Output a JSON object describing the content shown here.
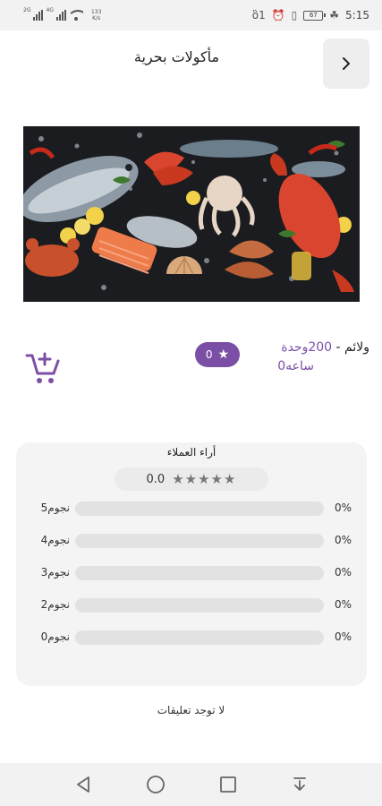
{
  "status_bar": {
    "net_tags": [
      "2G",
      "4G"
    ],
    "speed_value": "133",
    "speed_unit": "K/s",
    "battery": "67",
    "time": "5:15"
  },
  "header": {
    "title": "مأكولات بحرية",
    "back_icon": "chevron-right-icon"
  },
  "hero": {
    "alt": "seafood assortment"
  },
  "product": {
    "rating_value": "0",
    "units_prefix": "ولائم - ",
    "units_value": "200وحدة",
    "hours": "0ساعه",
    "cart_icon": "add-to-cart-icon"
  },
  "reviews": {
    "title": "أراء العملاء",
    "average": "0.0",
    "stars_filled": 0,
    "stars_total": 5,
    "distribution": [
      {
        "label": "5نجوم",
        "percent": "0%",
        "fraction": 0
      },
      {
        "label": "4نجوم",
        "percent": "0%",
        "fraction": 0
      },
      {
        "label": "3نجوم",
        "percent": "0%",
        "fraction": 0
      },
      {
        "label": "2نجوم",
        "percent": "0%",
        "fraction": 0
      },
      {
        "label": "0نجوم",
        "percent": "0%",
        "fraction": 0
      }
    ],
    "empty_message": "لا توجد تعليقات"
  },
  "nav_bar": {
    "buttons": [
      "back-triangle-icon",
      "home-circle-icon",
      "recents-square-icon",
      "notification-down-icon"
    ]
  },
  "colors": {
    "accent": "#7c4fa6",
    "card_bg": "#f4f4f4",
    "bar_track": "#e2e2e2"
  }
}
